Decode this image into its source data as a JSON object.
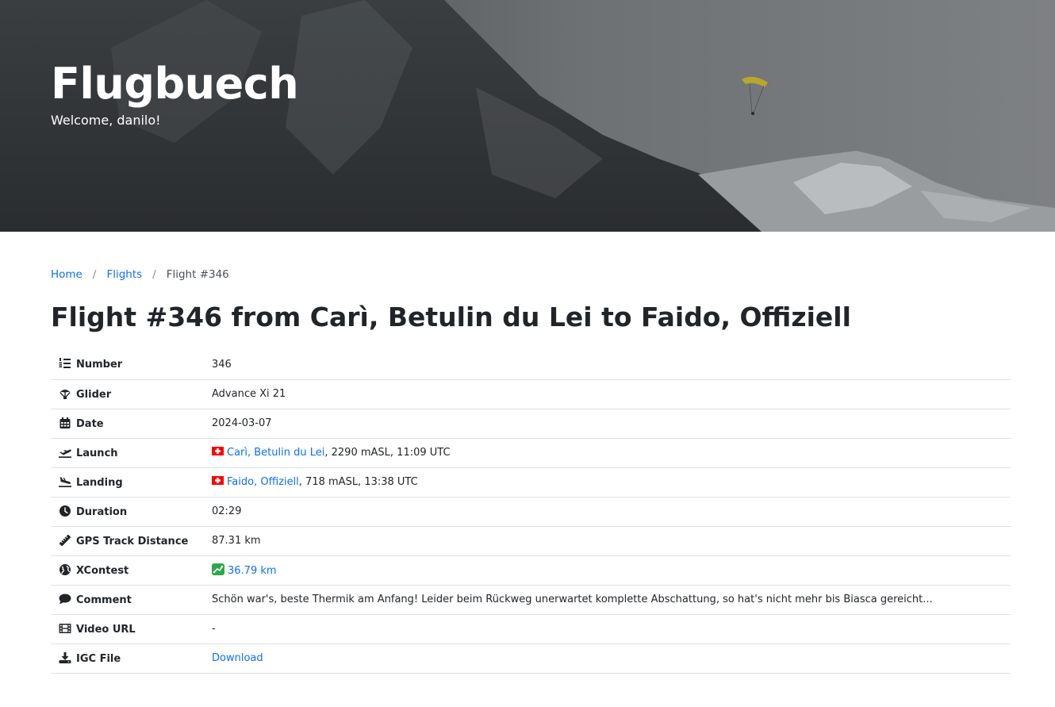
{
  "hero": {
    "title": "Flugbuech",
    "subtitle": "Welcome, danilo!"
  },
  "breadcrumb": {
    "home": "Home",
    "flights": "Flights",
    "current": "Flight #346",
    "separator": "/"
  },
  "page_title": "Flight #346 from Carì, Betulin du Lei to Faido, Offiziell",
  "details": {
    "number": {
      "label": "Number",
      "icon": "list-ol-icon",
      "value": "346"
    },
    "glider": {
      "label": "Glider",
      "icon": "parachute-icon",
      "value": "Advance Xi 21"
    },
    "date": {
      "label": "Date",
      "icon": "calendar-icon",
      "value": "2024-03-07"
    },
    "launch": {
      "label": "Launch",
      "icon": "plane-departure-icon",
      "flag": "swiss-flag-icon",
      "location": "Carì, Betulin du Lei",
      "info": ", 2290 mASL, 11:09 UTC"
    },
    "landing": {
      "label": "Landing",
      "icon": "plane-arrival-icon",
      "flag": "swiss-flag-icon",
      "location": "Faido, Offiziell",
      "info": ", 718 mASL, 13:38 UTC"
    },
    "duration": {
      "label": "Duration",
      "icon": "clock-icon",
      "value": "02:29"
    },
    "gps_distance": {
      "label": "GPS Track Distance",
      "icon": "ruler-icon",
      "value": "87.31 km"
    },
    "xcontest": {
      "label": "XContest",
      "icon": "globe-icon",
      "badge_icon": "xcontest-icon",
      "value": "36.79 km"
    },
    "comment": {
      "label": "Comment",
      "icon": "comment-icon",
      "value": "Schön war's, beste Thermik am Anfang! Leider beim Rückweg unerwartet komplette Abschattung, so hat's nicht mehr bis Biasca gereicht..."
    },
    "video_url": {
      "label": "Video URL",
      "icon": "film-icon",
      "value": "-"
    },
    "igc_file": {
      "label": "IGC File",
      "icon": "download-icon",
      "value": "Download"
    }
  },
  "colors": {
    "link": "#0d6efd",
    "text": "#212529",
    "border": "#dee2e6",
    "flag_red": "#ff0000"
  }
}
